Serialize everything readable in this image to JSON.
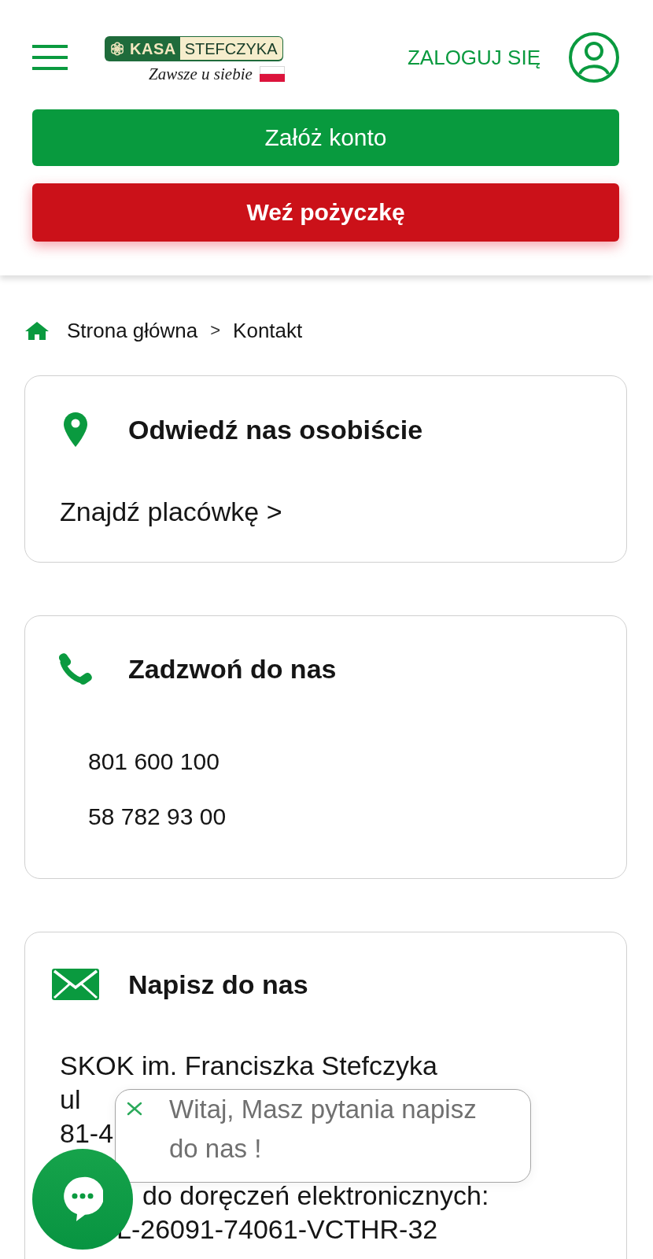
{
  "header": {
    "logo": {
      "brand": "KASA",
      "name": "STEFCZYKA",
      "tagline": "Zawsze u siebie"
    },
    "login": "ZALOGUJ SIĘ",
    "actions": [
      {
        "label": "Załóż konto",
        "kind": "open_account"
      },
      {
        "label": "Weź pożyczkę",
        "kind": "loan"
      }
    ]
  },
  "breadcrumb": {
    "items": [
      "Strona główna",
      "Kontakt"
    ],
    "separator": ">"
  },
  "cards": [
    {
      "kind": "visit",
      "title": "Odwiedź nas osobiście",
      "link": "Znajdź placówkę >"
    },
    {
      "kind": "call",
      "title": "Zadzwoń do nas",
      "lines": [
        "801 600 100",
        "58 782 93 00"
      ]
    },
    {
      "kind": "write",
      "title": "Napisz do nas",
      "paragraphs": [
        [
          "SKOK im. Franciszka Stefczyka",
          "ul",
          "81-4"
        ],
        [
          "do doręczeń elektronicznych:",
          "L-26091-74061-VCTHR-32"
        ]
      ]
    }
  ],
  "chat": {
    "message": "Witaj, Masz pytania napisz do nas !"
  }
}
